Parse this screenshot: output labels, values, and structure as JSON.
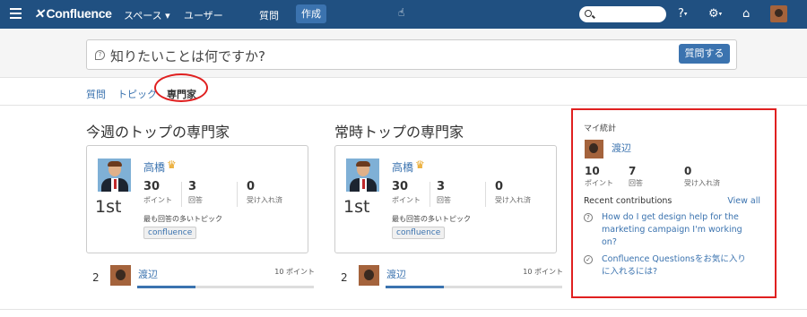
{
  "topnav": {
    "logo": "Confluence",
    "items": [
      "スペース ▾",
      "ユーザー",
      "質問"
    ],
    "create": "作成",
    "search_placeholder": "",
    "help_caret": "▾",
    "settings_caret": "▾"
  },
  "ask": {
    "placeholder": "知りたいことは何ですか?",
    "button": "質問する"
  },
  "tabs": [
    "質問",
    "トピック",
    "専門家"
  ],
  "weekly": {
    "title": "今週のトップの専門家",
    "top": {
      "rank": "1st",
      "name": "高橋",
      "stats": [
        {
          "num": "30",
          "label": "ポイント"
        },
        {
          "num": "3",
          "label": "回答"
        },
        {
          "num": "0",
          "label": "受け入れ済"
        }
      ],
      "topic_label": "最も回答の多いトピック",
      "topic": "confluence"
    },
    "second": {
      "rank": "2",
      "name": "渡辺",
      "points": "10 ポイント",
      "progress": 0.33
    }
  },
  "alltime": {
    "title": "常時トップの専門家",
    "top": {
      "rank": "1st",
      "name": "高橋",
      "stats": [
        {
          "num": "30",
          "label": "ポイント"
        },
        {
          "num": "3",
          "label": "回答"
        },
        {
          "num": "0",
          "label": "受け入れ済"
        }
      ],
      "topic_label": "最も回答の多いトピック",
      "topic": "confluence"
    },
    "second": {
      "rank": "2",
      "name": "渡辺",
      "points": "10 ポイント",
      "progress": 0.33
    }
  },
  "mystats": {
    "title": "マイ統計",
    "name": "渡辺",
    "stats": [
      {
        "num": "10",
        "label": "ポイント"
      },
      {
        "num": "7",
        "label": "回答"
      },
      {
        "num": "0",
        "label": "受け入れ済"
      }
    ],
    "recent_label": "Recent contributions",
    "view_all": "View all",
    "contributions": [
      {
        "icon": "question-icon",
        "text": "How do I get design help for the marketing campaign I'm working on?"
      },
      {
        "icon": "check-circle-icon",
        "text": "Confluence Questionsをお気に入りに入れるには?"
      }
    ]
  },
  "colors": {
    "nav": "#205081",
    "link": "#3b73af",
    "highlight": "#e02020"
  }
}
